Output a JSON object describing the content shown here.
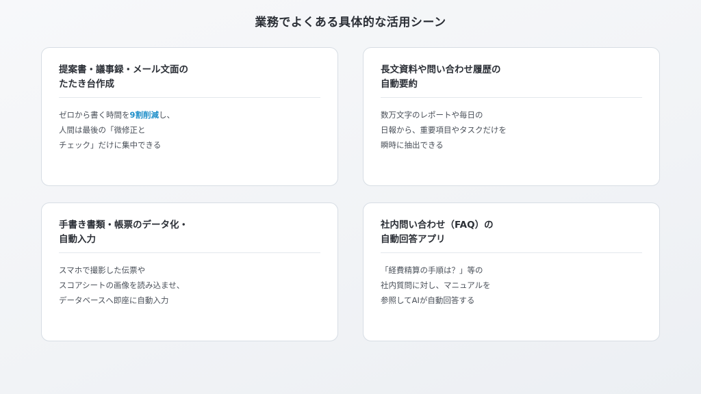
{
  "page": {
    "title": "業務でよくある具体的な活用シーン"
  },
  "cards": [
    {
      "title_lines": [
        "提案書・議事録・メール文面の",
        "たたき台作成"
      ],
      "body": {
        "line1_pre": "ゼロから書く時間を",
        "line1_highlight": "9割削減",
        "line1_post": "し、",
        "line2": "人間は最後の「微修正と",
        "line3": "チェック」だけに集中できる"
      }
    },
    {
      "title_lines": [
        "長文資料や問い合わせ履歴の",
        "自動要約"
      ],
      "body_lines": [
        "数万文字のレポートや毎日の",
        "日報から、重要項目やタスクだけを",
        "瞬時に抽出できる"
      ]
    },
    {
      "title_lines": [
        "手書き書類・帳票のデータ化・",
        "自動入力"
      ],
      "body_lines": [
        "スマホで撮影した伝票や",
        "スコアシートの画像を読み込ませ、",
        "データベースへ即座に自動入力"
      ]
    },
    {
      "title_lines": [
        "社内問い合わせ（FAQ）の",
        "自動回答アプリ"
      ],
      "body_lines": [
        "「経費精算の手順は？」等の",
        "社内質問に対し、マニュアルを",
        "参照してAIが自動回答する"
      ]
    }
  ],
  "colors": {
    "highlight": "#1f8fc9",
    "card_border": "#d7dde4",
    "text": "#2b2f36"
  }
}
